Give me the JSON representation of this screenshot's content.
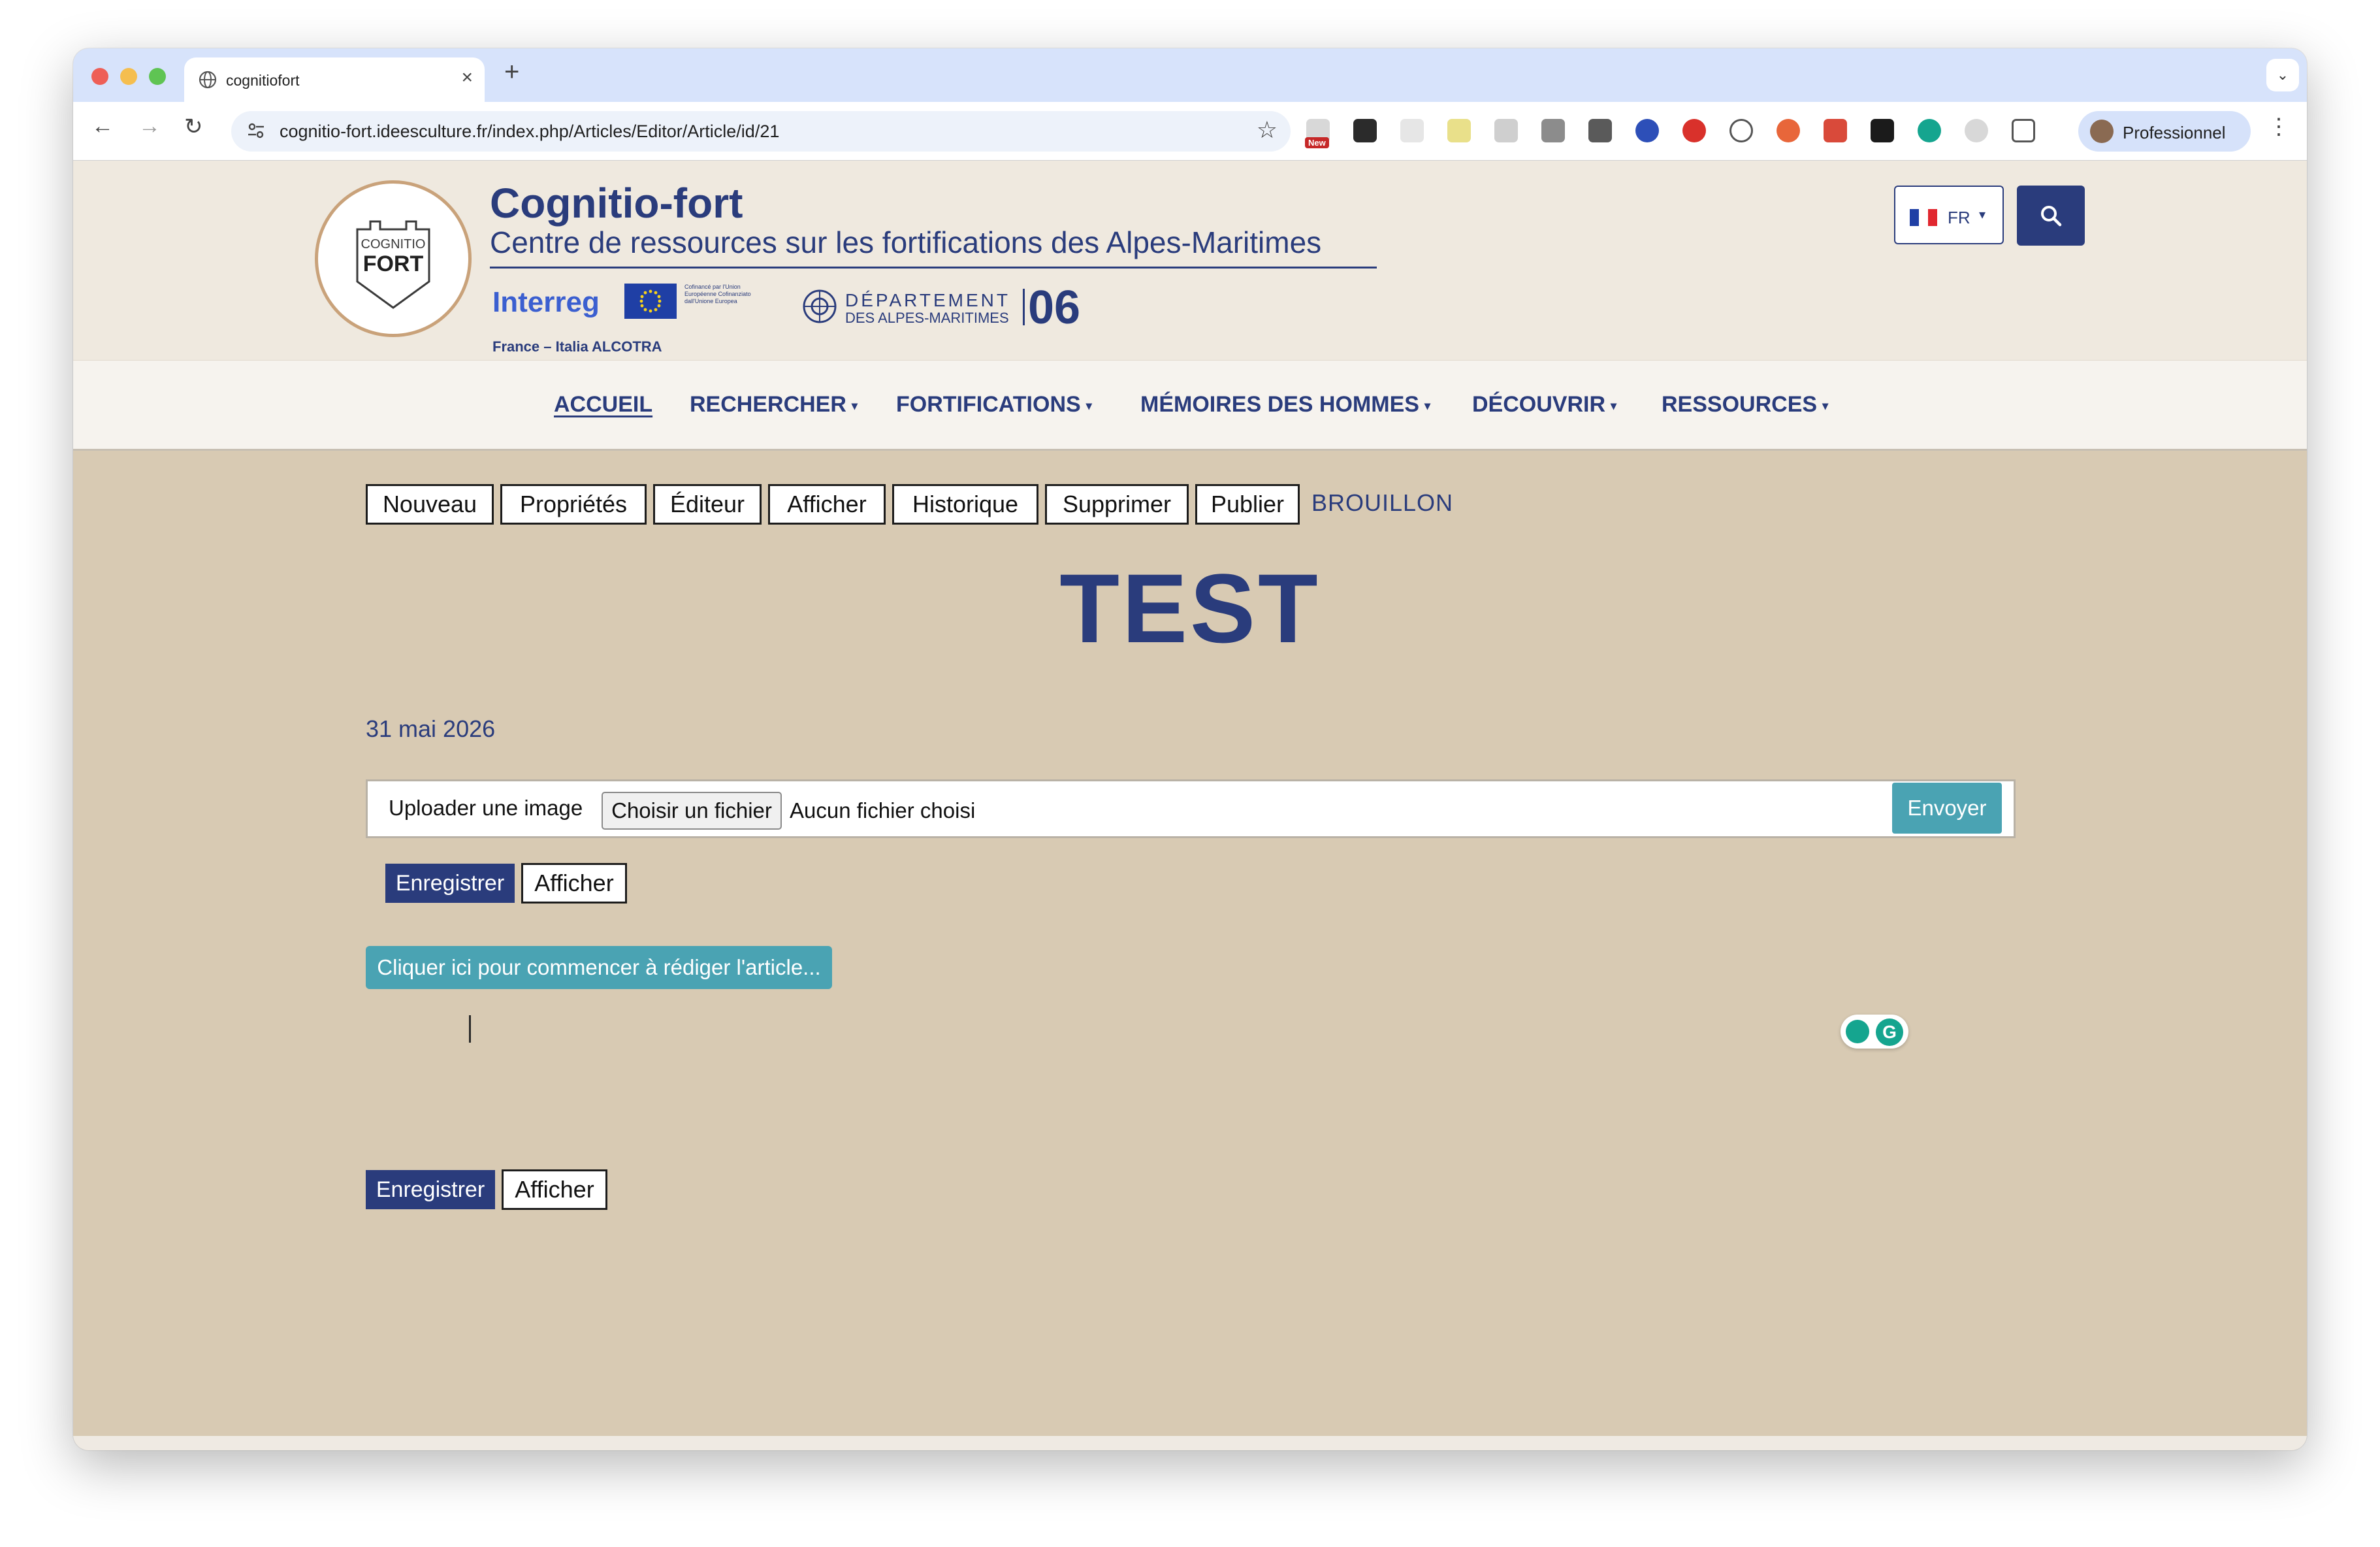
{
  "browser": {
    "tab_title": "cognitiofort",
    "tab_close": "×",
    "new_tab": "+",
    "tab_menu": "⌄",
    "back": "←",
    "forward": "→",
    "reload": "↻",
    "url": "cognitio-fort.ideesculture.fr/index.php/Articles/Editor/Article/id/21",
    "bookmark": "☆",
    "extension_new_badge": "New",
    "profile_label": "Professionnel",
    "menu": "⋮"
  },
  "site": {
    "logo_small": "COGNITIO",
    "logo_big": "FORT",
    "name": "Cognitio-fort",
    "subtitle": "Centre de ressources sur les fortifications des Alpes-Maritimes",
    "interreg": "Interreg",
    "eu_text": "Cofinancé par l'Union Européenne Cofinanziato dall'Unione Europea",
    "interreg_sub": "France – Italia ALCOTRA",
    "dept_line1": "DÉPARTEMENT",
    "dept_line2": "DES ALPES-MARITIMES",
    "dept_number": "06",
    "language": "FR",
    "caret": "▾"
  },
  "nav": {
    "items": [
      {
        "label": "ACCUEIL",
        "dropdown": ""
      },
      {
        "label": "RECHERCHER",
        "dropdown": "▾"
      },
      {
        "label": "FORTIFICATIONS",
        "dropdown": "▾"
      },
      {
        "label": "MÉMOIRES DES HOMMES",
        "dropdown": "▾"
      },
      {
        "label": "DÉCOUVRIR",
        "dropdown": "▾"
      },
      {
        "label": "RESSOURCES",
        "dropdown": "▾"
      }
    ]
  },
  "actions": {
    "new": "Nouveau",
    "properties": "Propriétés",
    "editor": "Éditeur",
    "show": "Afficher",
    "history": "Historique",
    "delete": "Supprimer",
    "publish": "Publier",
    "status": "BROUILLON"
  },
  "article": {
    "title": "TEST",
    "date": "31 mai 2026"
  },
  "upload": {
    "label": "Uploader une image",
    "choose_file": "Choisir un fichier",
    "no_file": "Aucun fichier choisi",
    "send": "Envoyer"
  },
  "editor": {
    "save": "Enregistrer",
    "show": "Afficher",
    "start_writing": "Cliquer ici pour commencer à rédiger l'article...",
    "grammarly_letter": "G"
  },
  "colors": {
    "brand_blue": "#2a3c7c",
    "header_bg": "#efe9df",
    "content_bg": "#d8cab3",
    "teal_button": "#4aa3b3"
  }
}
